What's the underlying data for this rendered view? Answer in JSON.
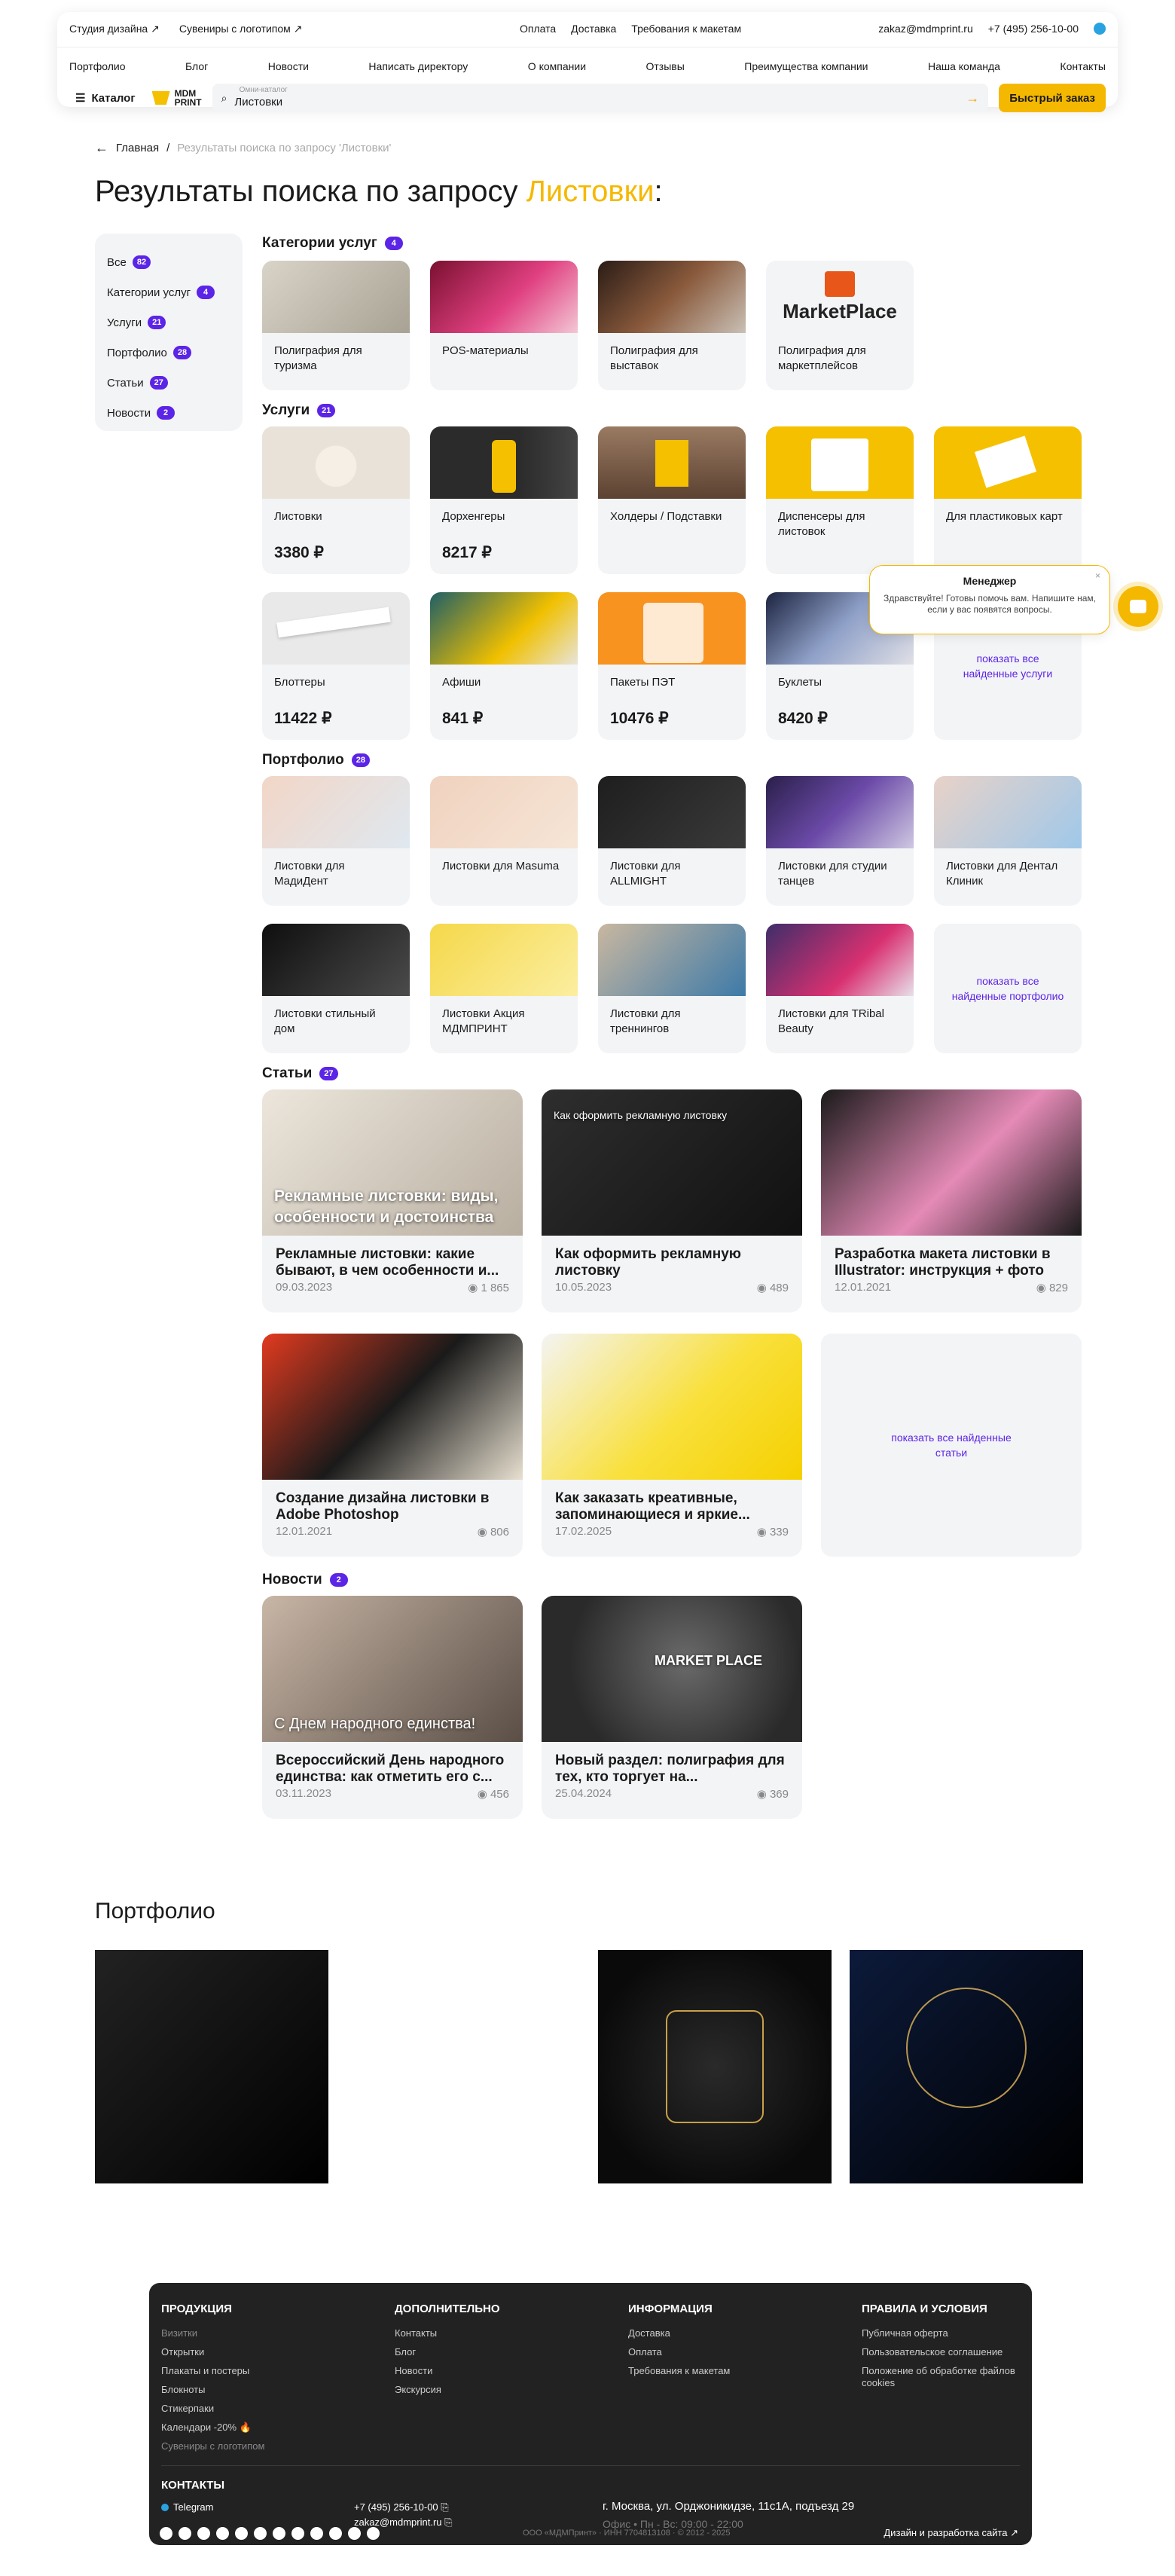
{
  "header": {
    "top_left": [
      "Студия дизайна ↗",
      "Сувениры с логотипом ↗"
    ],
    "top_center": [
      "Оплата",
      "Доставка",
      "Требования к макетам"
    ],
    "email": "zakaz@mdmprint.ru",
    "phone": "+7 (495) 256-10-00",
    "nav": [
      "Портфолио",
      "Блог",
      "Новости",
      "Написать директору",
      "О компании",
      "Отзывы",
      "Преимущества компании",
      "Наша команда",
      "Контакты"
    ],
    "catalog": "Каталог",
    "logo_line1": "MDM",
    "logo_line2": "PRINT",
    "search_placeholder": "Омни-каталог",
    "search_value": "Листовки",
    "quick_order": "Быстрый заказ"
  },
  "breadcrumb": {
    "home": "Главная",
    "sep": "/",
    "current": "Результаты поиска по запросу 'Листовки'"
  },
  "title": {
    "prefix": "Результаты поиска по запросу ",
    "query": "Листовки",
    "suffix": ":"
  },
  "sidebar": [
    {
      "label": "Все",
      "count": "82"
    },
    {
      "label": "Категории услуг",
      "count": "4"
    },
    {
      "label": "Услуги",
      "count": "21"
    },
    {
      "label": "Портфолио",
      "count": "28"
    },
    {
      "label": "Статьи",
      "count": "27"
    },
    {
      "label": "Новости",
      "count": "2"
    }
  ],
  "sections": {
    "categories": {
      "label": "Категории услуг",
      "count": "4",
      "items": [
        "Полиграфия для туризма",
        "POS-материалы",
        "Полиграфия для выставок",
        "Полиграфия для маркетплейсов"
      ],
      "mp_logo": "MarketPlace"
    },
    "services": {
      "label": "Услуги",
      "count": "21",
      "items": [
        {
          "t": "Листовки",
          "p": "3380 ₽"
        },
        {
          "t": "Дорхенгеры",
          "p": "8217 ₽"
        },
        {
          "t": "Холдеры / Подставки",
          "p": ""
        },
        {
          "t": "Диспенсеры для листовок",
          "p": ""
        },
        {
          "t": "Для пластиковых карт",
          "p": ""
        },
        {
          "t": "Блоттеры",
          "p": "11422 ₽"
        },
        {
          "t": "Афиши",
          "p": "841 ₽"
        },
        {
          "t": "Пакеты ПЭТ",
          "p": "10476 ₽"
        },
        {
          "t": "Буклеты",
          "p": "8420 ₽"
        }
      ],
      "show_all": "показать все найденные услуги"
    },
    "portfolio": {
      "label": "Портфолио",
      "count": "28",
      "items": [
        "Листовки для МадиДент",
        "Листовки для Masuma",
        "Листовки для ALLMIGHT",
        "Листовки для студии танцев",
        "Листовки для Дентал Клиник",
        "Листовки стильный дом",
        "Листовки Акция МДМПРИНТ",
        "Листовки для треннингов",
        "Листовки для TRibal Beauty"
      ],
      "show_all": "показать все найденные портфолио"
    },
    "articles": {
      "label": "Статьи",
      "count": "27",
      "items": [
        {
          "t": "Рекламные листовки: какие бывают, в чем особенности и...",
          "d": "09.03.2023",
          "v": "1 865",
          "ov": "Рекламные листовки: виды, особенности и достоинства"
        },
        {
          "t": "Как оформить рекламную листовку",
          "d": "10.05.2023",
          "v": "489",
          "ov": "Как оформить рекламную листовку"
        },
        {
          "t": "Разработка макета листовки в Illustrator: инструкция + фото",
          "d": "12.01.2021",
          "v": "829",
          "ov": ""
        },
        {
          "t": "Создание дизайна листовки в Adobe Photoshop",
          "d": "12.01.2021",
          "v": "806",
          "ov": ""
        },
        {
          "t": "Как заказать креативные, запоминающиеся и яркие...",
          "d": "17.02.2025",
          "v": "339",
          "ov": ""
        }
      ],
      "show_all": "показать все найденные статьи"
    },
    "news": {
      "label": "Новости",
      "count": "2",
      "items": [
        {
          "t": "Всероссийский День народного единства: как отметить его с...",
          "d": "03.11.2023",
          "v": "456",
          "ov": "С Днем народного единства!"
        },
        {
          "t": "Новый раздел: полиграфия для тех, кто торгует на...",
          "d": "25.04.2024",
          "v": "369",
          "ov": "MARKET PLACE"
        }
      ]
    }
  },
  "portfolio_block": {
    "title": "Портфолио"
  },
  "chat": {
    "title": "Менеджер",
    "text": "Здравствуйте! Готовы помочь вам. Напишите нам, если у вас появятся вопросы."
  },
  "footer": {
    "products": {
      "h": "ПРОДУКЦИЯ",
      "items": [
        "Визитки",
        "Открытки",
        "Плакаты и постеры",
        "Блокноты",
        "Стикерпаки",
        "Календари -20% 🔥",
        "Сувениры с логотипом"
      ]
    },
    "extra": {
      "h": "ДОПОЛНИТЕЛЬНО",
      "items": [
        "Контакты",
        "Блог",
        "Новости",
        "Экскурсия"
      ]
    },
    "info": {
      "h": "ИНФОРМАЦИЯ",
      "items": [
        "Доставка",
        "Оплата",
        "Требования к макетам"
      ]
    },
    "rules": {
      "h": "ПРАВИЛА И УСЛОВИЯ",
      "items": [
        "Публичная оферта",
        "Пользовательское соглашение",
        "Положение об обработке файлов cookies"
      ]
    },
    "contacts_h": "КОНТАКТЫ",
    "telegram": "Telegram",
    "phone": "+7 (495) 256-10-00 ⎘",
    "email": "zakaz@mdmprint.ru ⎘",
    "address": "г. Москва, ул. Орджоникидзе, 11с1А, подъезд 29",
    "hours": "Офис • Пн - Вс: 09:00 - 22:00",
    "company": "ООО «МДМПринт» · ИНН 7704813108 · © 2012 - 2025",
    "design": "Дизайн и разработка сайта ↗"
  }
}
